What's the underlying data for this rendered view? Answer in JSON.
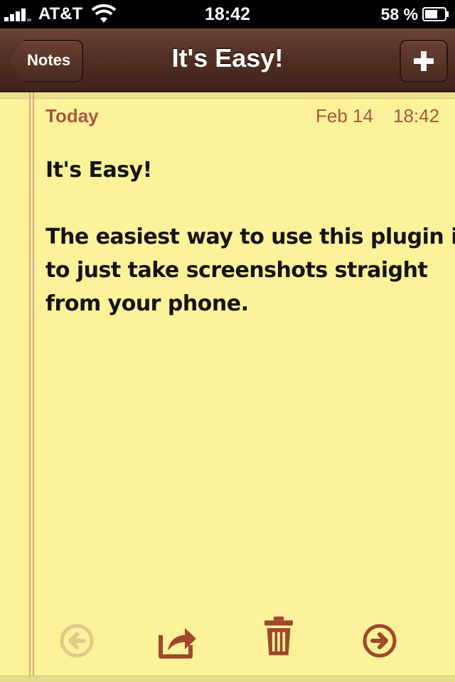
{
  "status_bar": {
    "carrier": "AT&T",
    "time": "18:42",
    "battery_percent": "58 %"
  },
  "nav": {
    "back_label": "Notes",
    "title": "It's Easy!",
    "add_label": "+"
  },
  "note": {
    "date_label": "Today",
    "date_day": "Feb 14",
    "date_time": "18:42",
    "lines": [
      "It's Easy!",
      "",
      "The easiest way to use this plugin is",
      "to just take screenshots straight",
      "from your phone."
    ]
  },
  "toolbar": {
    "icons": [
      "previous-note-icon",
      "share-icon",
      "trash-icon",
      "next-note-icon"
    ]
  },
  "colors": {
    "leather": "#553126",
    "paper": "#fbf29a",
    "accent_text": "#a8573b",
    "toolbar_icon": "#a0472c"
  }
}
